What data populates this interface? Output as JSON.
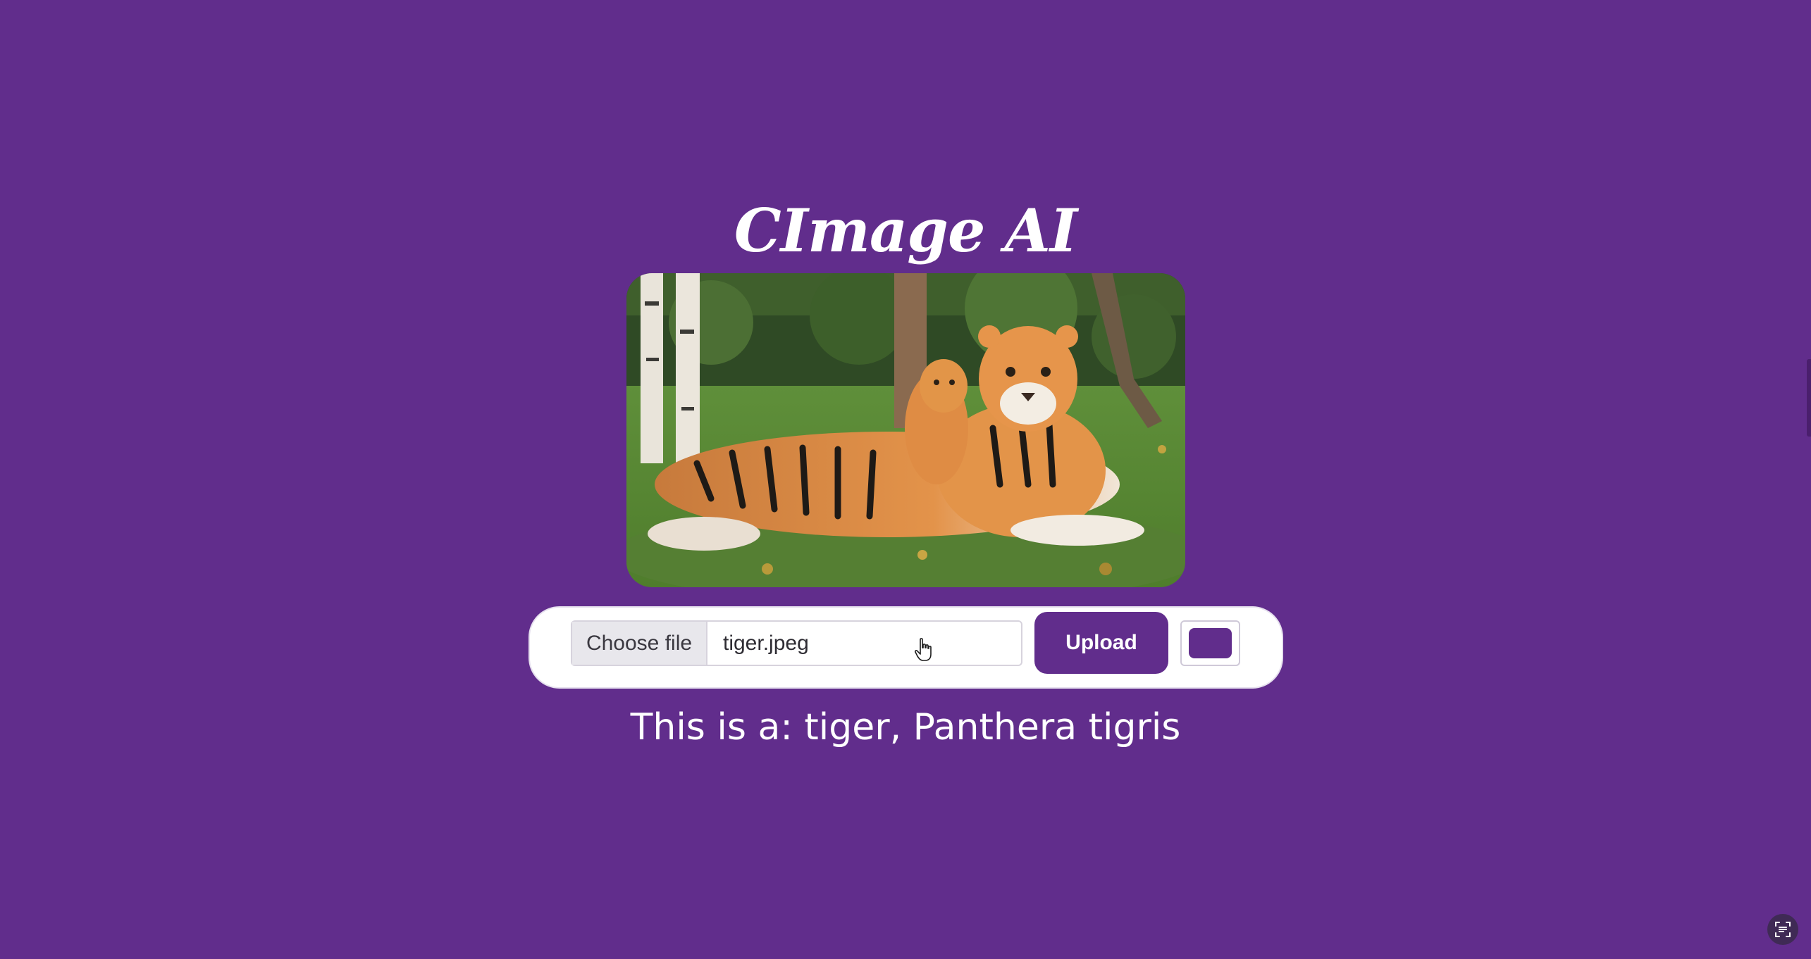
{
  "app": {
    "title": "CImage AI"
  },
  "upload_form": {
    "choose_file_label": "Choose file",
    "file_name": "tiger.jpeg",
    "upload_label": "Upload",
    "color_value": "#612d8c"
  },
  "result": {
    "text": "This is a: tiger, Panthera tigris"
  },
  "colors": {
    "background": "#612d8c",
    "card": "#ffffff",
    "accent": "#612d8c"
  },
  "icons": {
    "cursor": "hand-pointer-icon",
    "corner": "text-scan-icon"
  }
}
